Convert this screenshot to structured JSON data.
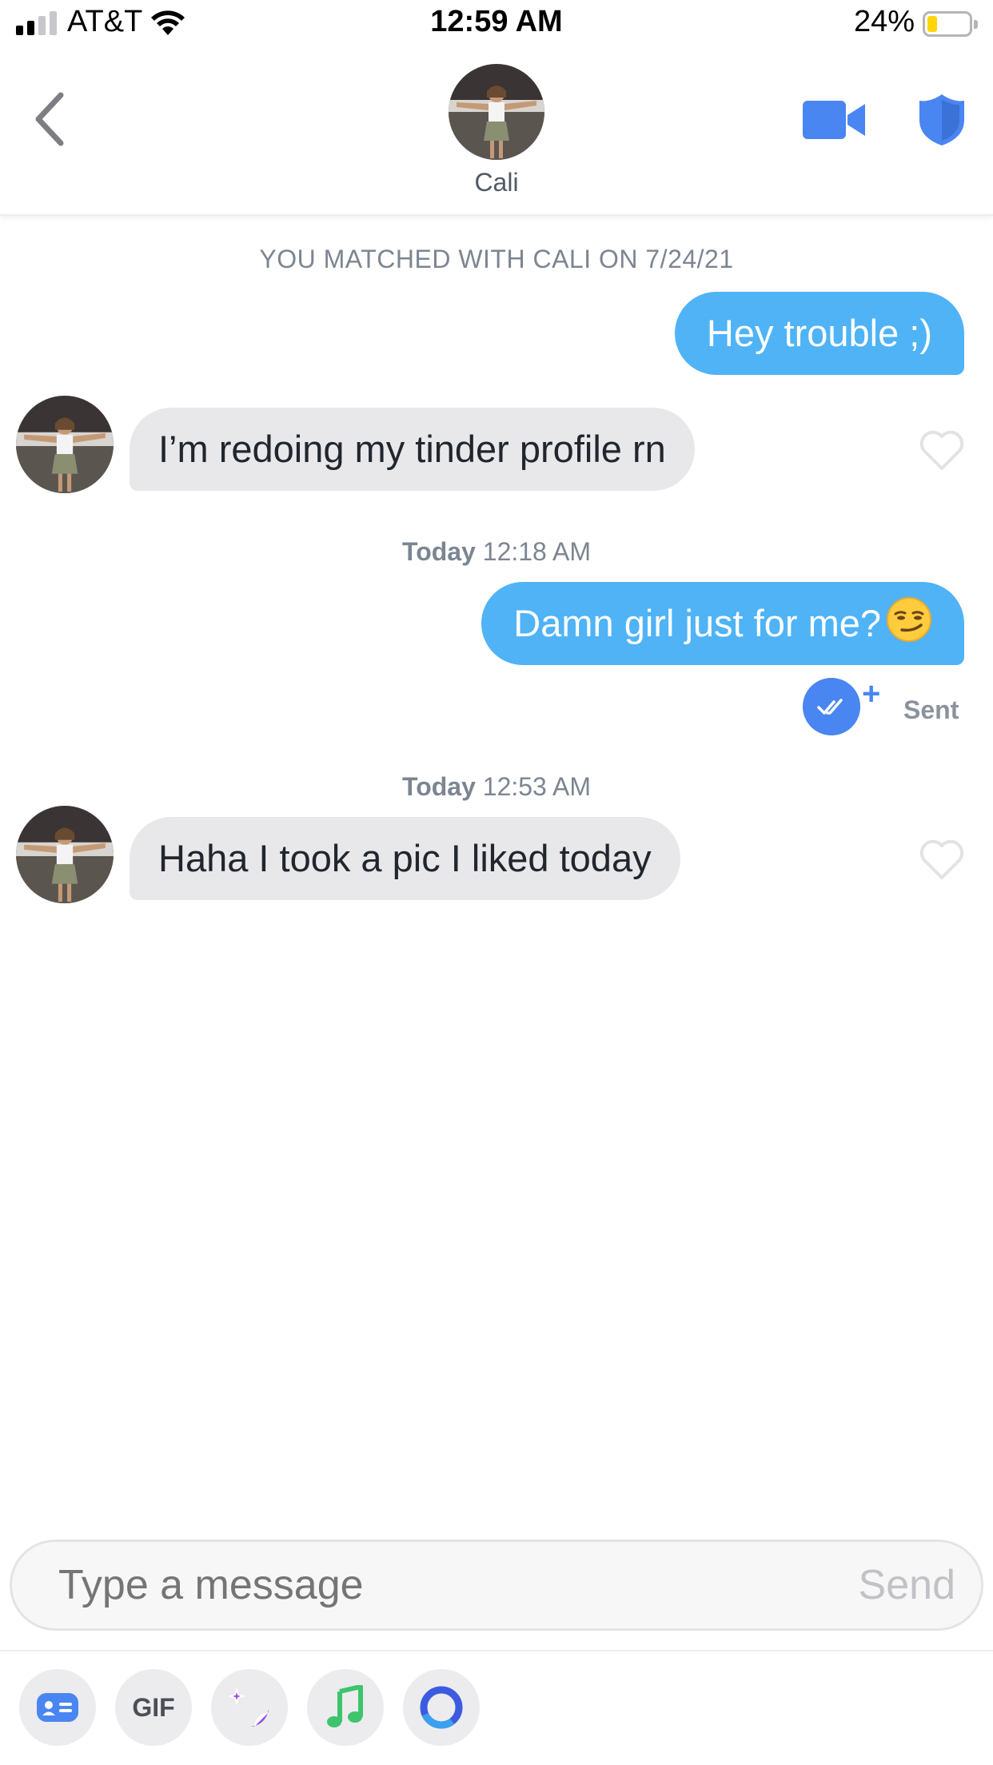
{
  "status_bar": {
    "carrier": "AT&T",
    "time": "12:59 AM",
    "battery_percent": "24%",
    "battery_level": 0.24,
    "battery_color": "#ffd60a"
  },
  "header": {
    "contact_name": "Cali",
    "accent_color": "#4a86f1",
    "back_icon": "chevron-left-icon",
    "video_icon": "video-camera-icon",
    "safety_icon": "shield-icon"
  },
  "chat": {
    "match_notice": "YOU MATCHED WITH CALI ON 7/24/21",
    "messages": [
      {
        "direction": "outgoing",
        "text": "Hey trouble ;)"
      },
      {
        "direction": "incoming",
        "text": "I’m redoing my tinder profile rn"
      },
      {
        "type": "timestamp",
        "day": "Today",
        "time": "12:18 AM"
      },
      {
        "direction": "outgoing",
        "text": "Damn girl just for me?",
        "emoji": "smirking-face"
      },
      {
        "type": "receipt",
        "label": "Sent"
      },
      {
        "type": "timestamp",
        "day": "Today",
        "time": "12:53 AM"
      },
      {
        "direction": "incoming",
        "text": "Haha I took a pic I liked today"
      }
    ],
    "outgoing_color": "#4fb3f6",
    "incoming_color": "#e8e8ea"
  },
  "composer": {
    "placeholder": "Type a message",
    "send_label": "Send"
  },
  "toolbar": {
    "items": [
      {
        "name": "profile-card-icon"
      },
      {
        "name": "gif-button",
        "label": "GIF"
      },
      {
        "name": "sticker-icon"
      },
      {
        "name": "music-note-icon"
      },
      {
        "name": "ring-icon"
      }
    ]
  }
}
